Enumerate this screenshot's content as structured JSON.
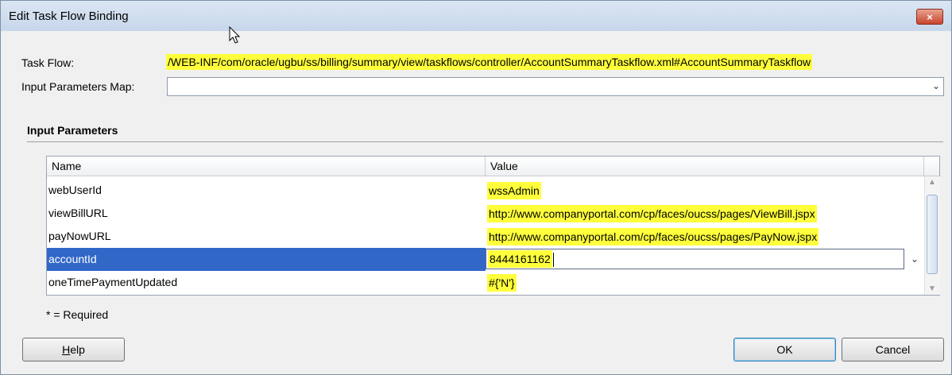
{
  "window": {
    "title": "Edit Task Flow Binding",
    "close_icon": "×"
  },
  "form": {
    "task_flow_label": "Task Flow:",
    "task_flow_value": "/WEB-INF/com/oracle/ugbu/ss/billing/summary/view/taskflows/controller/AccountSummaryTaskflow.xml#AccountSummaryTaskflow",
    "input_params_map_label": "Input Parameters Map:",
    "input_params_map_value": ""
  },
  "params_section": {
    "title": "Input Parameters",
    "columns": [
      "Name",
      "Value"
    ],
    "rows": [
      {
        "name": "webUserId",
        "value": "wssAdmin"
      },
      {
        "name": "viewBillURL",
        "value": "http://www.companyportal.com/cp/faces/oucss/pages/ViewBill.jspx"
      },
      {
        "name": "payNowURL",
        "value": "http://www.companyportal.com/cp/faces/oucss/pages/PayNow.jspx"
      },
      {
        "name": "accountId",
        "value": "8444161162"
      },
      {
        "name": "oneTimePaymentUpdated",
        "value": "#{'N'}"
      }
    ],
    "selected_row": "accountId",
    "required_note": "* = Required"
  },
  "buttons": {
    "help_mnemonic": "H",
    "help_rest": "elp",
    "ok": "OK",
    "cancel": "Cancel"
  },
  "colors": {
    "highlight": "#ffff3c",
    "selection": "#3168c8"
  }
}
